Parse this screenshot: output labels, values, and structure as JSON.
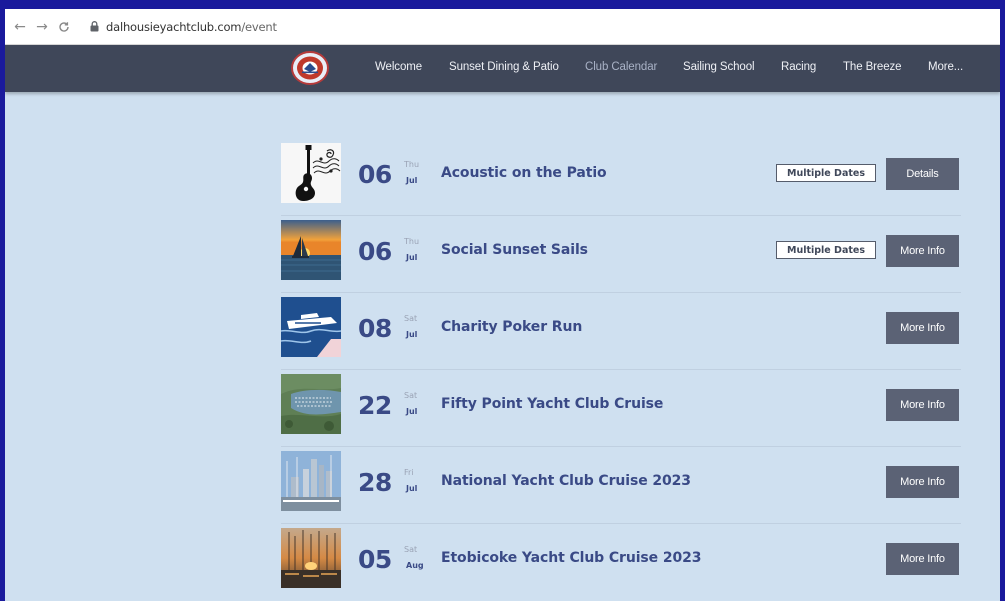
{
  "browser": {
    "url_host": "dalhousieyachtclub.com",
    "url_path": "/event"
  },
  "nav": {
    "links": [
      "Welcome",
      "Sunset Dining & Patio",
      "Club Calendar",
      "Sailing School",
      "Racing",
      "The Breeze",
      "More..."
    ],
    "active": "Club Calendar"
  },
  "events": [
    {
      "day": "06",
      "dow": "Thu",
      "month": "Jul",
      "title": "Acoustic on the Patio",
      "multi": "Multiple Dates",
      "button": "Details",
      "thumb": "guitar-music-image"
    },
    {
      "day": "06",
      "dow": "Thu",
      "month": "Jul",
      "title": "Social Sunset Sails",
      "multi": "Multiple Dates",
      "button": "More Info",
      "thumb": "sunset-sailboat-image"
    },
    {
      "day": "08",
      "dow": "Sat",
      "month": "Jul",
      "title": "Charity Poker Run",
      "multi": "",
      "button": "More Info",
      "thumb": "powerboat-image"
    },
    {
      "day": "22",
      "dow": "Sat",
      "month": "Jul",
      "title": "Fifty Point Yacht Club Cruise",
      "multi": "",
      "button": "More Info",
      "thumb": "marina-aerial-image"
    },
    {
      "day": "28",
      "dow": "Fri",
      "month": "Jul",
      "title": "National Yacht Club Cruise 2023",
      "multi": "",
      "button": "More Info",
      "thumb": "city-marina-image"
    },
    {
      "day": "05",
      "dow": "Sat",
      "month": "Aug",
      "title": "Etobicoke Yacht Club Cruise 2023",
      "multi": "",
      "button": "More Info",
      "thumb": "marina-sunset-image"
    }
  ],
  "colors": {
    "nav_bg": "#3f4759",
    "page_bg": "#cfe0f0",
    "accent_text": "#3a4a86",
    "button_bg": "#5b6275"
  }
}
